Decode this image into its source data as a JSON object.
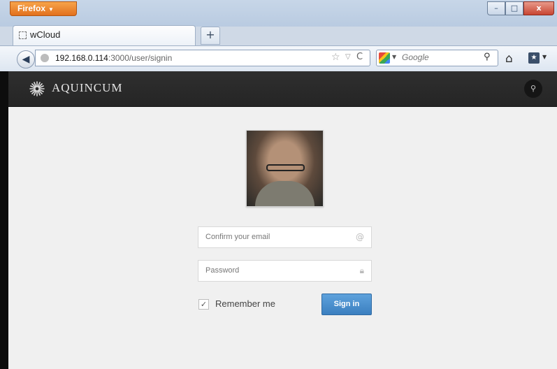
{
  "browser": {
    "menu_button": "Firefox",
    "window_controls": {
      "minimize": "–",
      "maximize": "□",
      "close": "x"
    },
    "tab": {
      "title": "wCloud"
    },
    "new_tab_symbol": "+",
    "url": {
      "host": "192.168.0.114",
      "path": ":3000/user/signin"
    },
    "search": {
      "placeholder": "Google",
      "engine_icon": "google-icon"
    }
  },
  "app": {
    "brand": "AQUINCUM",
    "search_icon": "search-icon"
  },
  "signin": {
    "email_placeholder": "Confirm your email",
    "password_placeholder": "Password",
    "email_icon": "@",
    "remember_label": "Remember me",
    "remember_checked": true,
    "submit_label": "Sign in"
  },
  "colors": {
    "header_bg": "#2a2a2a",
    "page_bg": "#f0f0f0",
    "primary_button": "#4a8fd0",
    "firefox_orange": "#e8802a"
  }
}
